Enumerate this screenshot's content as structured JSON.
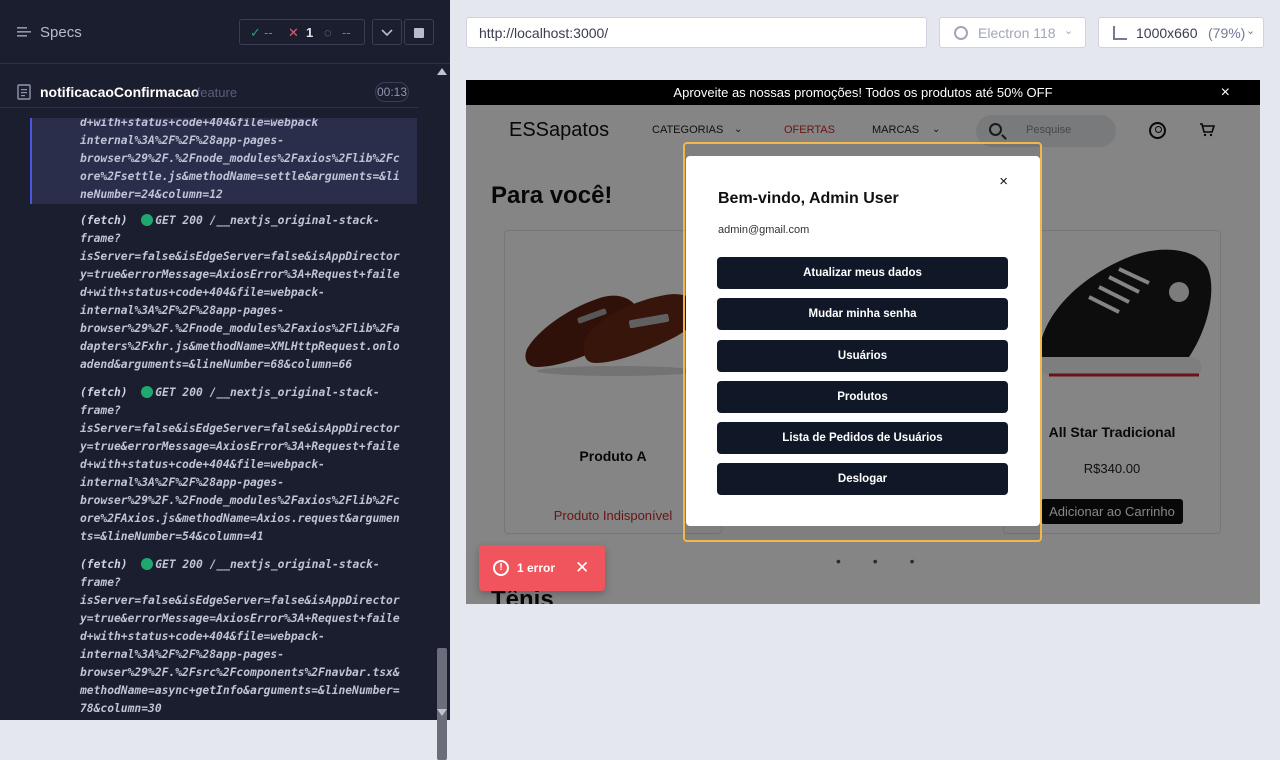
{
  "runner": {
    "specs_label": "Specs",
    "stats": {
      "pass_icon": "✓",
      "passed": "--",
      "fail_icon": "✕",
      "failed": "1",
      "pending_icon": "◌",
      "pending": "--"
    },
    "spec": {
      "name": "notificacaoConfirmacao",
      "ext": ".feature",
      "duration": "00:13"
    },
    "log_entries": [
      {
        "prefix": "",
        "lines": [
          "d+with+status+code+404&file=webpack",
          "internal%3A%2F%2F%28app-pages-",
          "browser%29%2F.%2Fnode_modules%2Faxios%2Flib%2Fc",
          "ore%2Fsettle.js&methodName=settle&arguments=&li",
          "neNumber=24&column=12"
        ]
      },
      {
        "prefix": "(fetch)",
        "method": "GET 200 /__nextjs_original-stack-",
        "lines": [
          "frame?",
          "isServer=false&isEdgeServer=false&isAppDirector",
          "y=true&errorMessage=AxiosError%3A+Request+faile",
          "d+with+status+code+404&file=webpack-",
          "internal%3A%2F%2F%28app-pages-",
          "browser%29%2F.%2Fnode_modules%2Faxios%2Flib%2Fa",
          "dapters%2Fxhr.js&methodName=XMLHttpRequest.onlo",
          "adend&arguments=&lineNumber=68&column=66"
        ]
      },
      {
        "prefix": "(fetch)",
        "method": "GET 200 /__nextjs_original-stack-",
        "lines": [
          "frame?",
          "isServer=false&isEdgeServer=false&isAppDirector",
          "y=true&errorMessage=AxiosError%3A+Request+faile",
          "d+with+status+code+404&file=webpack-",
          "internal%3A%2F%2F%28app-pages-",
          "browser%29%2F.%2Fnode_modules%2Faxios%2Flib%2Fc",
          "ore%2FAxios.js&methodName=Axios.request&argumen",
          "ts=&lineNumber=54&column=41"
        ]
      },
      {
        "prefix": "(fetch)",
        "method": "GET 200 /__nextjs_original-stack-",
        "lines": [
          "frame?",
          "isServer=false&isEdgeServer=false&isAppDirector",
          "y=true&errorMessage=AxiosError%3A+Request+faile",
          "d+with+status+code+404&file=webpack-",
          "internal%3A%2F%2F%28app-pages-",
          "browser%29%2F.%2Fsrc%2Fcomponents%2Fnavbar.tsx&",
          "methodName=async+getInfo&arguments=&lineNumber=",
          "78&column=30"
        ]
      }
    ]
  },
  "browser": {
    "url": "http://localhost:3000/",
    "browser_name": "Electron 118",
    "viewport": "1000x660",
    "zoom": "(79%)"
  },
  "app": {
    "promo": "Aproveite as nossas promoções! Todos os produtos até 50% OFF",
    "promo_close": "×",
    "logo": "ESSapatos",
    "nav": {
      "categories": "CATEGORIAS",
      "offers": "OFERTAS",
      "brands": "MARCAS",
      "search_placeholder": "Pesquise"
    },
    "section_title": "Para você!",
    "section_title2": "Tênis",
    "products": [
      {
        "name": "Produto A",
        "status": "Produto Indisponível"
      },
      {
        "name": "All Star Tradicional",
        "price": "R$340.00",
        "button": "Adicionar ao Carrinho"
      }
    ],
    "carousel_dots": "• • •"
  },
  "modal": {
    "close": "×",
    "title": "Bem-vindo, Admin User",
    "email": "admin@gmail.com",
    "buttons": [
      "Atualizar meus dados",
      "Mudar minha senha",
      "Usuários",
      "Produtos",
      "Lista de Pedidos de Usuários",
      "Deslogar"
    ]
  },
  "error_toast": {
    "icon": "!",
    "label": "1 error",
    "close": "✕"
  },
  "colors": {
    "runner_bg": "#1b1e2e",
    "modal_button": "#101828",
    "offer_red": "#cc2a2a",
    "error_red": "#f0555d",
    "highlight_border": "#f0b84a"
  }
}
